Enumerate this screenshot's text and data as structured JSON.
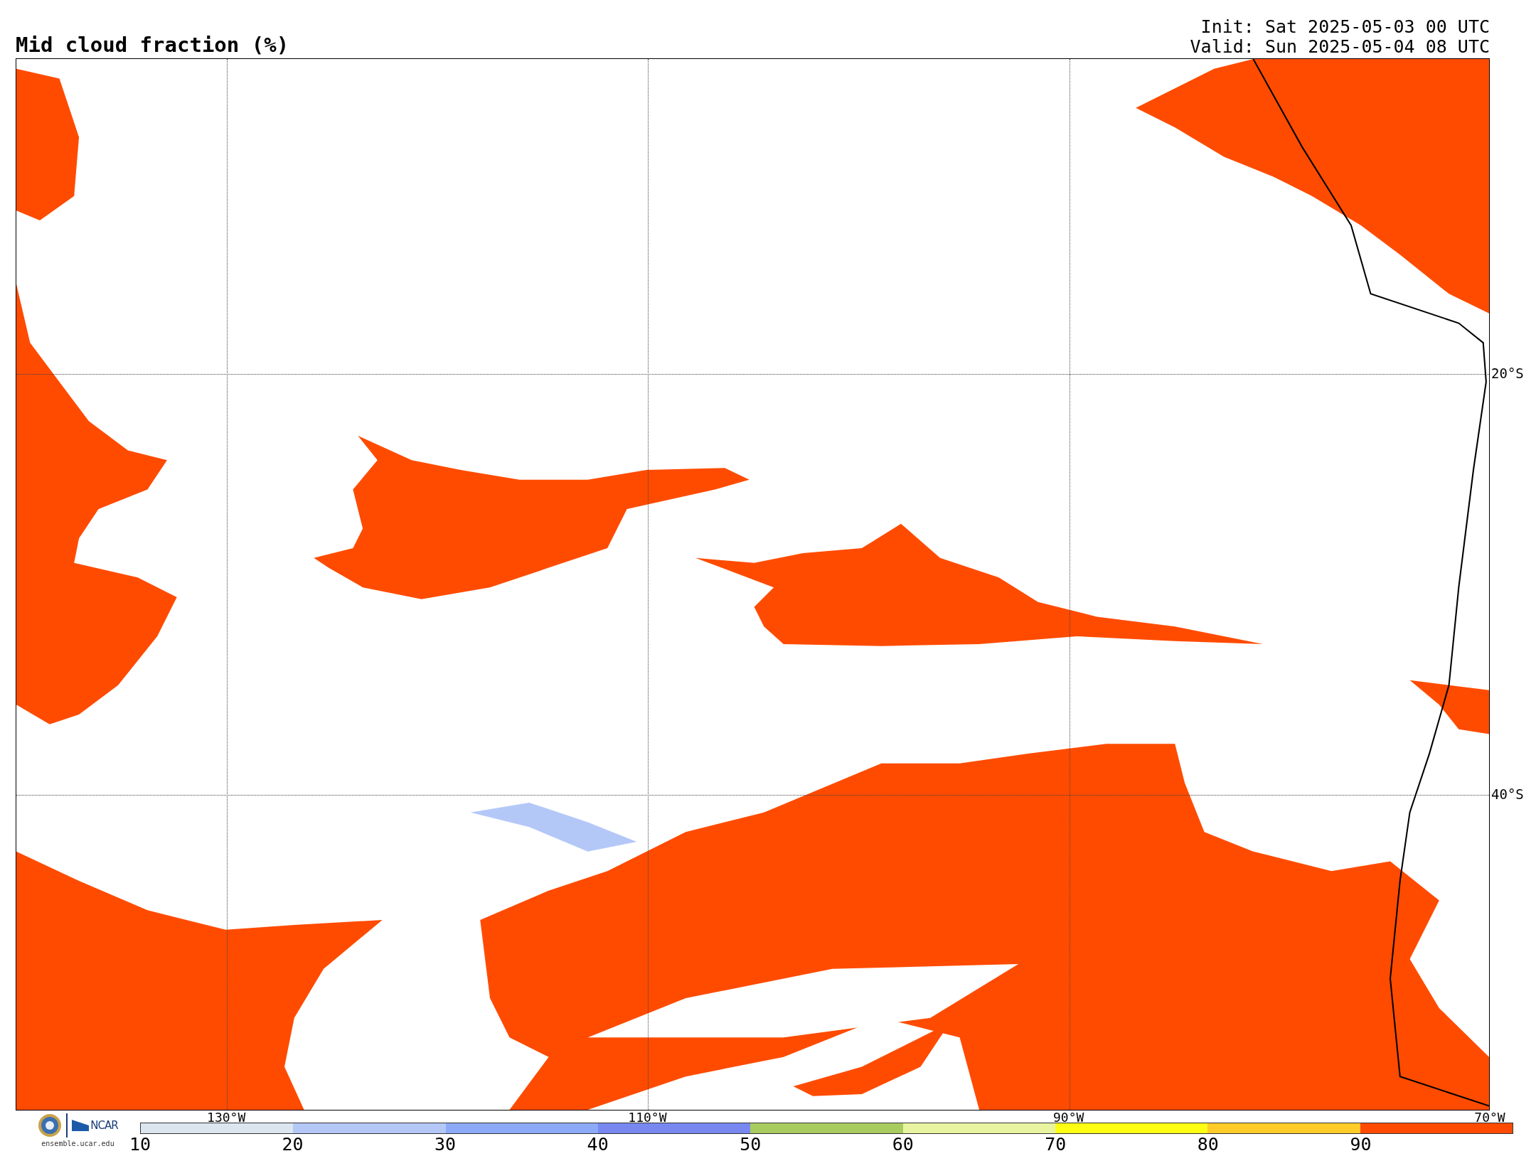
{
  "title": "Mid cloud fraction (%)",
  "init": "Init: Sat 2025-05-03 00 UTC",
  "valid": "Valid: Sun 2025-05-04 08 UTC",
  "map": {
    "lon_labels": [
      "130°W",
      "110°W",
      "90°W",
      "70°W"
    ],
    "lat_labels": [
      "20°S",
      "40°S"
    ]
  },
  "footer": {
    "logo_text": "NCAR",
    "url": "ensemble.ucar.edu"
  },
  "colorbar": {
    "bins": [
      {
        "color": "#dce6ee"
      },
      {
        "color": "#b4c8f8"
      },
      {
        "color": "#8caaf8"
      },
      {
        "color": "#7888f0"
      },
      {
        "color": "#a8cc60"
      },
      {
        "color": "#e8f4a0"
      },
      {
        "color": "#ffff14"
      },
      {
        "color": "#ffcc28"
      },
      {
        "color": "#ff4b00"
      }
    ],
    "ticks": [
      "10",
      "20",
      "30",
      "40",
      "50",
      "60",
      "70",
      "80",
      "90"
    ]
  }
}
